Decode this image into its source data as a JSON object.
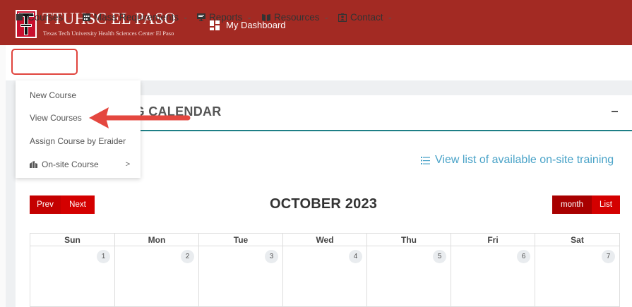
{
  "header": {
    "brand_title": "TTUHSC EL PASO",
    "brand_subtitle": "Texas Tech University Health Sciences Center El Paso",
    "dashboard_label": "My Dashboard"
  },
  "nav": {
    "items": [
      {
        "label": "Courses",
        "icon": "courses-icon"
      },
      {
        "label": "Mass Requirements",
        "icon": "calendar-grid-icon"
      },
      {
        "label": "Reports",
        "icon": "monitor-icon"
      },
      {
        "label": "Resources",
        "icon": "book-icon"
      },
      {
        "label": "Contact",
        "icon": "contact-card-icon"
      }
    ]
  },
  "dropdown": {
    "items": [
      {
        "label": "New Course"
      },
      {
        "label": "View Courses"
      },
      {
        "label": "Assign Course by Eraider"
      },
      {
        "label": "On-site Course",
        "icon": "building-icon",
        "submenu_indicator": ">"
      }
    ]
  },
  "card": {
    "title": "ING CALENDAR",
    "collapse_label": "–",
    "onsite_link": "View list of available on-site training"
  },
  "calendar": {
    "prev_label": "Prev",
    "next_label": "Next",
    "month_label": "OCTOBER 2023",
    "view_month_label": "month",
    "view_list_label": "List",
    "weekdays": [
      "Sun",
      "Mon",
      "Tue",
      "Wed",
      "Thu",
      "Fri",
      "Sat"
    ],
    "days": [
      "1",
      "2",
      "3",
      "4",
      "5",
      "6",
      "7"
    ]
  },
  "colors": {
    "header_red": "#a32a23",
    "button_red": "#cc0000",
    "accent_teal": "#1e7f86",
    "link_blue": "#4aa3c8",
    "highlight_red": "#e0443d"
  }
}
